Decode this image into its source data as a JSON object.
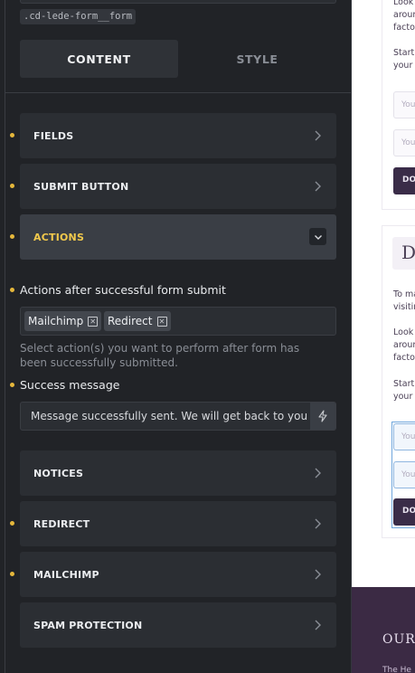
{
  "panel": {
    "css_class": ".cd-lede-form__form",
    "tabs": [
      {
        "label": "CONTENT",
        "active": true
      },
      {
        "label": "STYLE",
        "active": false
      }
    ],
    "sections": {
      "fields": "FIELDS",
      "submit_button": "SUBMIT BUTTON",
      "actions": "ACTIONS",
      "notices": "NOTICES",
      "redirect": "REDIRECT",
      "mailchimp": "MAILCHIMP",
      "spam_protection": "SPAM PROTECTION"
    },
    "actions_after_submit": {
      "label": "Actions after successful form submit",
      "tags": [
        "Mailchimp",
        "Redirect"
      ],
      "help": "Select action(s) you want to perform after form has been successfully submitted."
    },
    "success_message": {
      "label": "Success message",
      "value": "Message successfully sent. We will get back to you as soon as possible."
    }
  },
  "preview": {
    "card1": {
      "line1": "Look",
      "line2": "arour",
      "line3": "factor",
      "line4": "Start",
      "line5": "your",
      "input1": "You",
      "input2": "You",
      "button": "DO"
    },
    "card2": {
      "heading": "D",
      "p1a": "To ma",
      "p1b": "visitin",
      "p2a": "Look",
      "p2b": "arour",
      "p2c": "factor",
      "p3a": "Start",
      "p3b": "your",
      "input1": "You",
      "input2": "You",
      "button": "DO"
    },
    "footer": {
      "title": "OUR",
      "subtitle": "The He"
    }
  },
  "colors": {
    "panel_bg": "#212327",
    "section_bg": "#2b2e33",
    "accent_yellow": "#f2c94c",
    "preview_button": "#3a2c48",
    "footer_bg": "#3b2a44"
  }
}
